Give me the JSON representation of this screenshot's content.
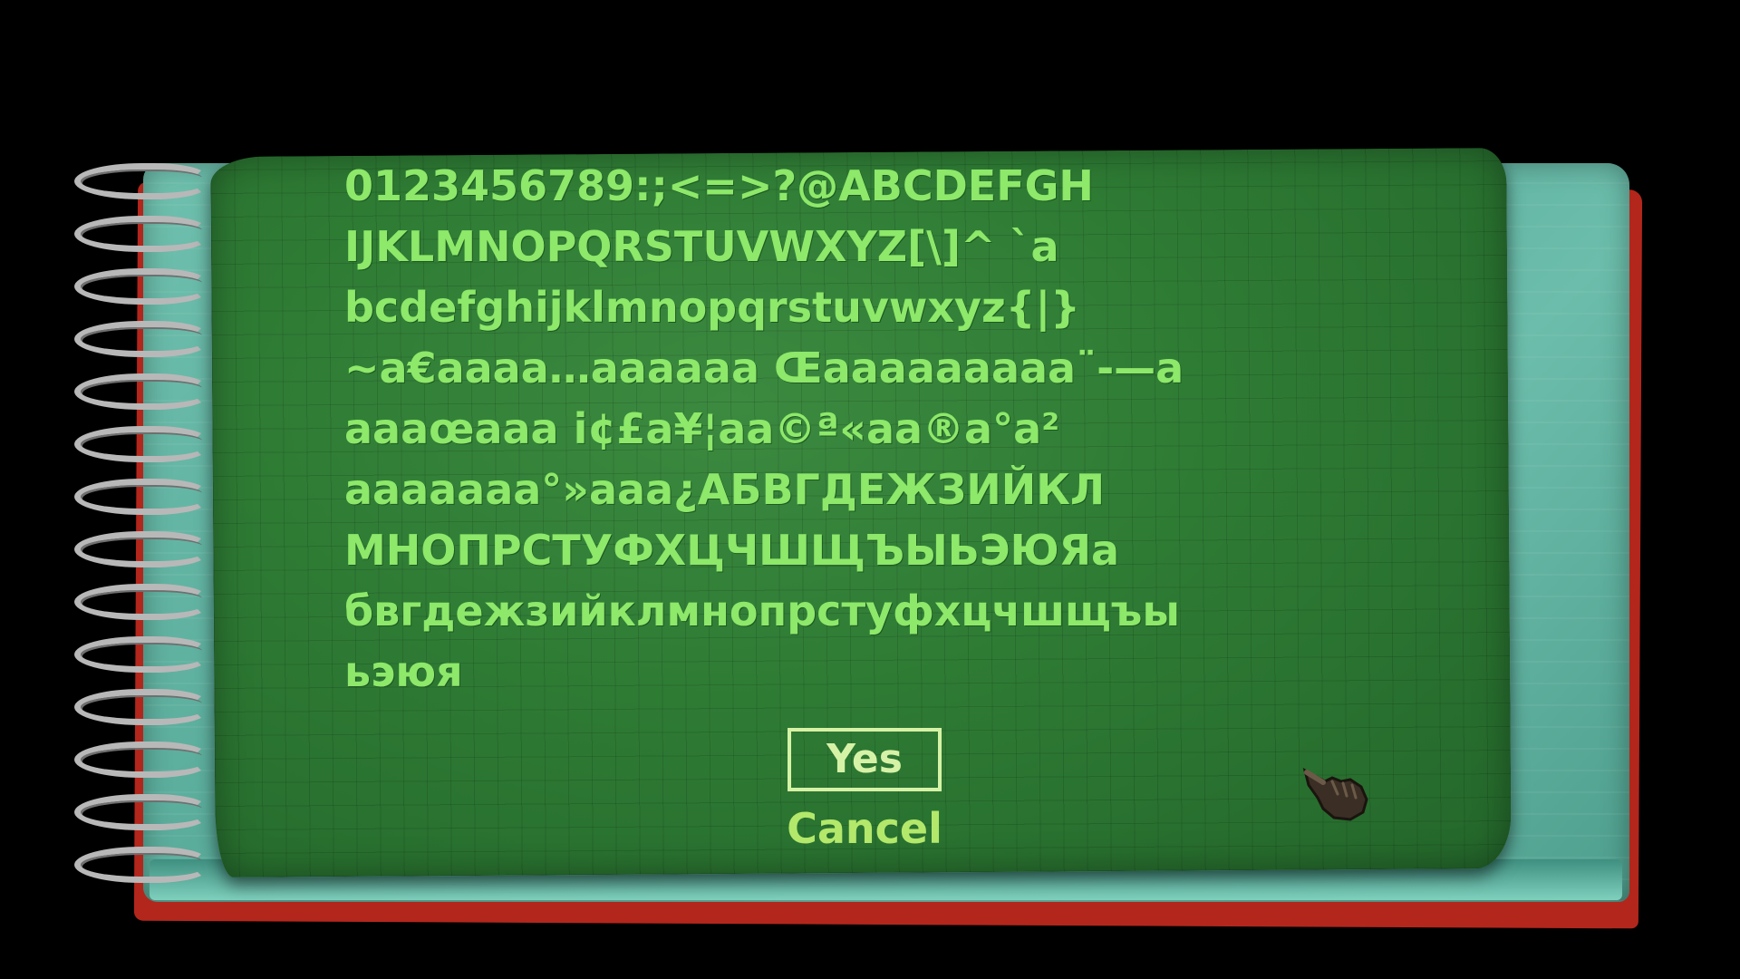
{
  "glyph_sheet": {
    "rows": [
      "0123456789:;<=>?@ABCDEFGH",
      "IJKLMNOPQRSTUVWXYZ[\\]^ `a",
      "bcdefghijklmnopqrstuvwxyz{|}",
      "~a€aaaa…aaaaaa Œaaaaaaaaa¨-—a",
      "aaaœaaa i¢£a¥¦aa©ª«aa®a°a²",
      "aaaaaaa°»aaa¿АБВГДЕЖЗИЙКЛ",
      "МНОПРСТУФХЦЧШЩЪЫЬЭЮЯа",
      "бвгдежзийклмнопрстуфхцчшщъы",
      "ьэюя"
    ]
  },
  "dialog": {
    "yes_label": "Yes",
    "cancel_label": "Cancel"
  },
  "icons": {
    "cursor": "pointing-hand-icon"
  },
  "colors": {
    "background": "#000000",
    "sheet_green": "#2e7b34",
    "glyph_green": "#8ee86a",
    "teal_page": "#5fb3a2",
    "red_edge": "#b3261c",
    "button_text": "#d6f2a6"
  }
}
